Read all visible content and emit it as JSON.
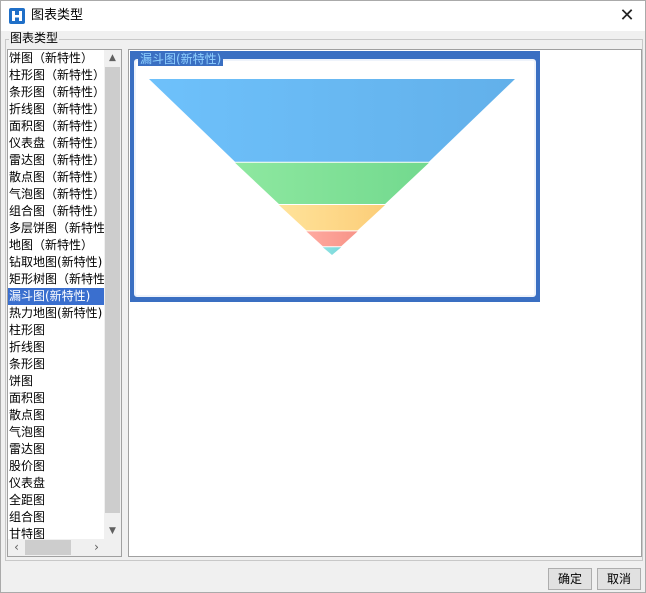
{
  "window": {
    "title": "图表类型",
    "close_glyph": "✕"
  },
  "group_label": "图表类型",
  "chart_types": [
    {
      "label": "饼图（新特性）",
      "selected": false
    },
    {
      "label": "柱形图（新特性）",
      "selected": false
    },
    {
      "label": "条形图（新特性）",
      "selected": false
    },
    {
      "label": "折线图（新特性）",
      "selected": false
    },
    {
      "label": "面积图（新特性）",
      "selected": false
    },
    {
      "label": "仪表盘（新特性）",
      "selected": false
    },
    {
      "label": "雷达图（新特性）",
      "selected": false
    },
    {
      "label": "散点图（新特性）",
      "selected": false
    },
    {
      "label": "气泡图（新特性）",
      "selected": false
    },
    {
      "label": "组合图（新特性）",
      "selected": false
    },
    {
      "label": "多层饼图（新特性）",
      "selected": false
    },
    {
      "label": "地图（新特性）",
      "selected": false
    },
    {
      "label": "钻取地图(新特性)",
      "selected": false
    },
    {
      "label": "矩形树图（新特性）",
      "selected": false
    },
    {
      "label": "漏斗图(新特性)",
      "selected": true
    },
    {
      "label": "热力地图(新特性)",
      "selected": false
    },
    {
      "label": "柱形图",
      "selected": false
    },
    {
      "label": "折线图",
      "selected": false
    },
    {
      "label": "条形图",
      "selected": false
    },
    {
      "label": "饼图",
      "selected": false
    },
    {
      "label": "面积图",
      "selected": false
    },
    {
      "label": "散点图",
      "selected": false
    },
    {
      "label": "气泡图",
      "selected": false
    },
    {
      "label": "雷达图",
      "selected": false
    },
    {
      "label": "股价图",
      "selected": false
    },
    {
      "label": "仪表盘",
      "selected": false
    },
    {
      "label": "全距图",
      "selected": false
    },
    {
      "label": "组合图",
      "selected": false
    },
    {
      "label": "甘特图",
      "selected": false
    }
  ],
  "scrollbar_glyphs": {
    "up": "▲",
    "down": "▼",
    "left": "‹",
    "right": "›"
  },
  "preview": {
    "label": "漏斗图(新特性)"
  },
  "chart_data": {
    "type": "funnel",
    "stages": [
      {
        "value": 100,
        "color_from": "#6ec1fb",
        "color_to": "#62b0ea"
      },
      {
        "value": 76,
        "color_from": "#8ee8a0",
        "color_to": "#72d98e"
      },
      {
        "value": 45,
        "color_from": "#ffe39a",
        "color_to": "#fccd78"
      },
      {
        "value": 24,
        "color_from": "#ffaaa0",
        "color_to": "#f79488"
      },
      {
        "value": 9,
        "color_from": "#8fe3e3",
        "color_to": "#7ad8da"
      }
    ],
    "band_height_shares": [
      0.47,
      0.24,
      0.15,
      0.09,
      0.05
    ]
  },
  "buttons": {
    "ok": "确定",
    "cancel": "取消"
  }
}
